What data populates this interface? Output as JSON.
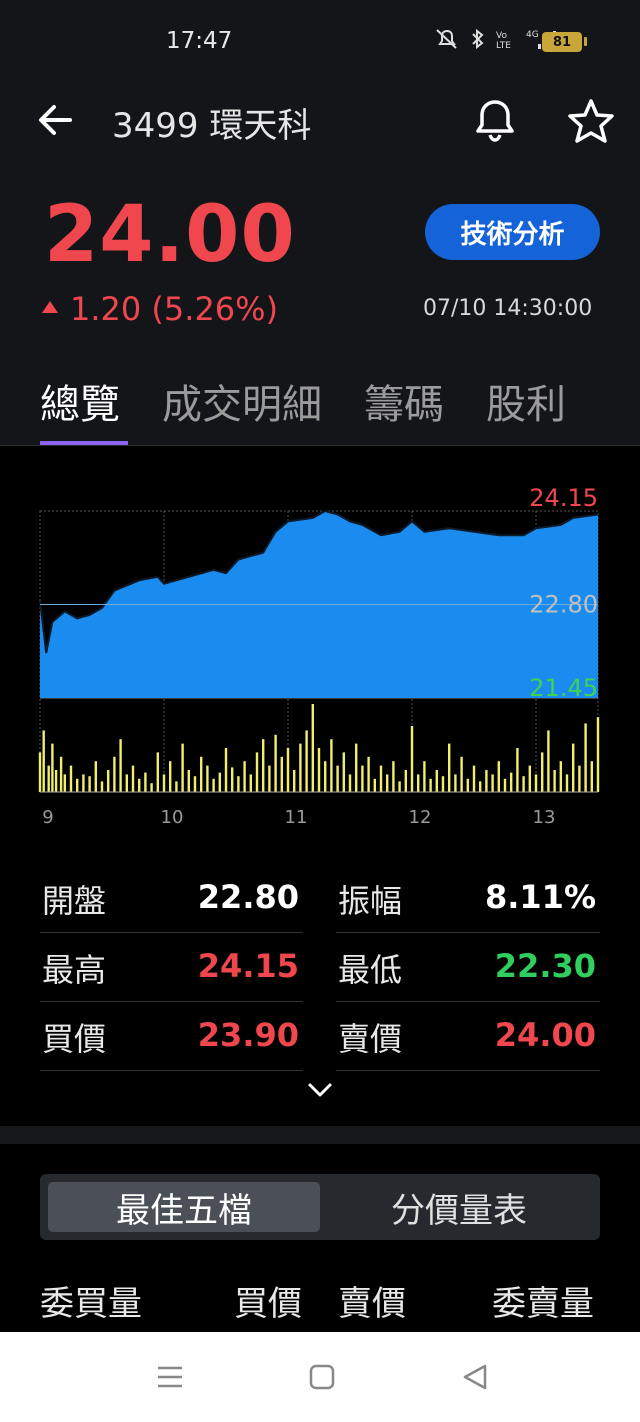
{
  "status_bar": {
    "time": "17:47",
    "battery": "81",
    "icons": [
      "mute-icon",
      "bluetooth-icon",
      "volte-icon",
      "signal-4g-icon"
    ]
  },
  "header": {
    "title": "3499 環天科",
    "icons": [
      "back-arrow-icon",
      "bell-icon",
      "star-icon"
    ]
  },
  "quote": {
    "price": "24.00",
    "change": "1.20 (5.26%)",
    "timestamp": "07/10 14:30:00",
    "tech_button": "技術分析"
  },
  "tabs": [
    {
      "label": "總覽",
      "active": true
    },
    {
      "label": "成交明細"
    },
    {
      "label": "籌碼"
    },
    {
      "label": "股利"
    }
  ],
  "chart_data": {
    "type": "area",
    "y_ticks": [
      "24.15",
      "22.80",
      "21.45"
    ],
    "x_ticks": [
      "9",
      "10",
      "11",
      "12",
      "13"
    ],
    "ylim": [
      21.45,
      24.15
    ],
    "reference": 22.8,
    "price_series": [
      [
        9.0,
        22.85
      ],
      [
        9.05,
        22.1
      ],
      [
        9.1,
        22.55
      ],
      [
        9.2,
        22.7
      ],
      [
        9.3,
        22.6
      ],
      [
        9.4,
        22.65
      ],
      [
        9.5,
        22.75
      ],
      [
        9.6,
        23.0
      ],
      [
        9.8,
        23.15
      ],
      [
        9.95,
        23.2
      ],
      [
        10.0,
        23.1
      ],
      [
        10.2,
        23.2
      ],
      [
        10.4,
        23.3
      ],
      [
        10.5,
        23.25
      ],
      [
        10.6,
        23.45
      ],
      [
        10.8,
        23.55
      ],
      [
        10.9,
        23.85
      ],
      [
        11.0,
        24.0
      ],
      [
        11.2,
        24.05
      ],
      [
        11.3,
        24.15
      ],
      [
        11.4,
        24.1
      ],
      [
        11.5,
        24.0
      ],
      [
        11.6,
        23.95
      ],
      [
        11.75,
        23.8
      ],
      [
        11.9,
        23.85
      ],
      [
        12.0,
        24.0
      ],
      [
        12.1,
        23.85
      ],
      [
        12.3,
        23.9
      ],
      [
        12.5,
        23.85
      ],
      [
        12.7,
        23.8
      ],
      [
        12.9,
        23.8
      ],
      [
        13.0,
        23.9
      ],
      [
        13.2,
        23.95
      ],
      [
        13.3,
        24.05
      ],
      [
        13.5,
        24.1
      ]
    ],
    "x_range": [
      9.0,
      13.5
    ],
    "volume_series": [
      [
        9.0,
        0.45
      ],
      [
        9.03,
        0.7
      ],
      [
        9.07,
        0.3
      ],
      [
        9.1,
        0.55
      ],
      [
        9.13,
        0.25
      ],
      [
        9.17,
        0.4
      ],
      [
        9.2,
        0.2
      ],
      [
        9.25,
        0.3
      ],
      [
        9.3,
        0.15
      ],
      [
        9.35,
        0.2
      ],
      [
        9.4,
        0.18
      ],
      [
        9.45,
        0.35
      ],
      [
        9.5,
        0.12
      ],
      [
        9.55,
        0.25
      ],
      [
        9.6,
        0.4
      ],
      [
        9.65,
        0.6
      ],
      [
        9.7,
        0.2
      ],
      [
        9.75,
        0.3
      ],
      [
        9.8,
        0.15
      ],
      [
        9.85,
        0.22
      ],
      [
        9.9,
        0.1
      ],
      [
        9.95,
        0.45
      ],
      [
        10.0,
        0.2
      ],
      [
        10.05,
        0.35
      ],
      [
        10.1,
        0.12
      ],
      [
        10.15,
        0.55
      ],
      [
        10.2,
        0.25
      ],
      [
        10.25,
        0.18
      ],
      [
        10.3,
        0.4
      ],
      [
        10.35,
        0.3
      ],
      [
        10.4,
        0.15
      ],
      [
        10.45,
        0.22
      ],
      [
        10.5,
        0.5
      ],
      [
        10.55,
        0.28
      ],
      [
        10.6,
        0.18
      ],
      [
        10.65,
        0.35
      ],
      [
        10.7,
        0.2
      ],
      [
        10.75,
        0.45
      ],
      [
        10.8,
        0.6
      ],
      [
        10.85,
        0.3
      ],
      [
        10.9,
        0.65
      ],
      [
        10.95,
        0.4
      ],
      [
        11.0,
        0.5
      ],
      [
        11.05,
        0.25
      ],
      [
        11.1,
        0.55
      ],
      [
        11.15,
        0.7
      ],
      [
        11.2,
        1.0
      ],
      [
        11.25,
        0.5
      ],
      [
        11.3,
        0.35
      ],
      [
        11.35,
        0.6
      ],
      [
        11.4,
        0.3
      ],
      [
        11.45,
        0.45
      ],
      [
        11.5,
        0.2
      ],
      [
        11.55,
        0.55
      ],
      [
        11.6,
        0.3
      ],
      [
        11.65,
        0.4
      ],
      [
        11.7,
        0.15
      ],
      [
        11.75,
        0.3
      ],
      [
        11.8,
        0.2
      ],
      [
        11.85,
        0.35
      ],
      [
        11.9,
        0.12
      ],
      [
        11.95,
        0.25
      ],
      [
        12.0,
        0.75
      ],
      [
        12.05,
        0.2
      ],
      [
        12.1,
        0.35
      ],
      [
        12.15,
        0.15
      ],
      [
        12.2,
        0.25
      ],
      [
        12.25,
        0.18
      ],
      [
        12.3,
        0.55
      ],
      [
        12.35,
        0.2
      ],
      [
        12.4,
        0.4
      ],
      [
        12.45,
        0.15
      ],
      [
        12.5,
        0.3
      ],
      [
        12.55,
        0.12
      ],
      [
        12.6,
        0.25
      ],
      [
        12.65,
        0.2
      ],
      [
        12.7,
        0.35
      ],
      [
        12.75,
        0.15
      ],
      [
        12.8,
        0.22
      ],
      [
        12.85,
        0.5
      ],
      [
        12.9,
        0.18
      ],
      [
        12.95,
        0.3
      ],
      [
        13.0,
        0.2
      ],
      [
        13.05,
        0.45
      ],
      [
        13.1,
        0.7
      ],
      [
        13.15,
        0.25
      ],
      [
        13.2,
        0.35
      ],
      [
        13.25,
        0.2
      ],
      [
        13.3,
        0.55
      ],
      [
        13.35,
        0.3
      ],
      [
        13.4,
        0.78
      ],
      [
        13.45,
        0.35
      ],
      [
        13.5,
        0.85
      ]
    ],
    "colors": {
      "area": "#1a8cf0",
      "volume": "#f0ee6a",
      "high": "#f0474f",
      "ref": "#bfbfbf",
      "low": "#3fd44f"
    }
  },
  "stats": [
    {
      "label": "開盤",
      "value": "22.80",
      "color": "#ffffff",
      "label2": "振幅",
      "value2": "8.11%",
      "color2": "#ffffff"
    },
    {
      "label": "最高",
      "value": "24.15",
      "color": "#f0474f",
      "label2": "最低",
      "value2": "22.30",
      "color2": "#2fce5e"
    },
    {
      "label": "買價",
      "value": "23.90",
      "color": "#f0474f",
      "label2": "賣價",
      "value2": "24.00",
      "color2": "#f0474f"
    }
  ],
  "segment": {
    "left": "最佳五檔",
    "right": "分價量表"
  },
  "orderbook_header": {
    "bid_vol": "委買量",
    "bid": "買價",
    "ask": "賣價",
    "ask_vol": "委賣量"
  },
  "colors": {
    "up": "#f0474f",
    "down": "#2fce5e",
    "accent": "#1463d8",
    "tab_indicator": "#8b63f2"
  }
}
